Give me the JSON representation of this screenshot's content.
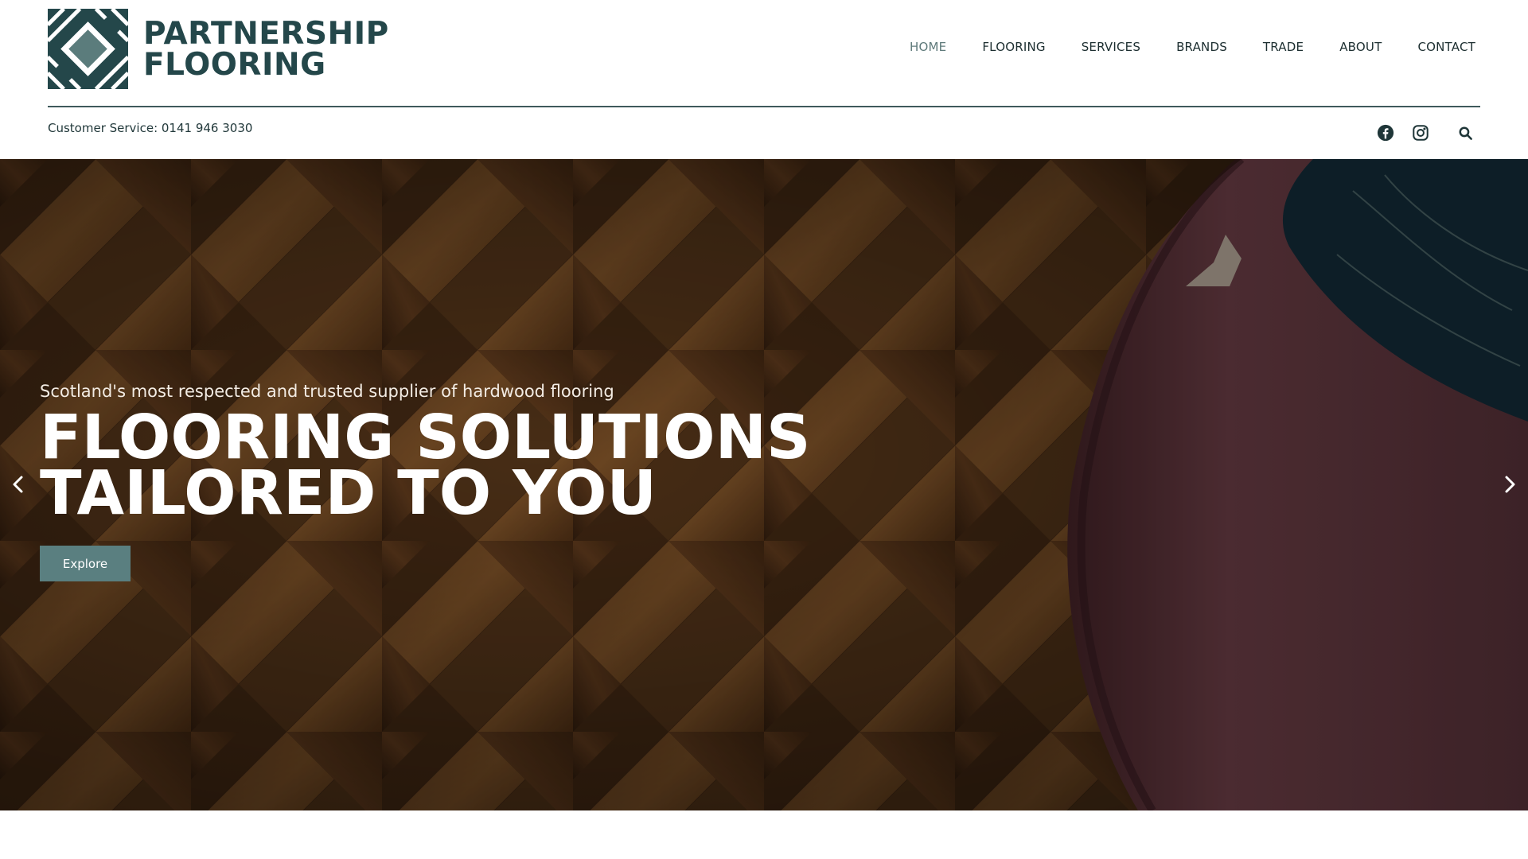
{
  "brand": {
    "line1": "PARTNERSHIP",
    "line2": "FLOORING",
    "color": "#24474a"
  },
  "nav": {
    "items": [
      {
        "label": "HOME",
        "active": true
      },
      {
        "label": "FLOORING",
        "active": false
      },
      {
        "label": "SERVICES",
        "active": false
      },
      {
        "label": "BRANDS",
        "active": false
      },
      {
        "label": "TRADE",
        "active": false
      },
      {
        "label": "ABOUT",
        "active": false
      },
      {
        "label": "CONTACT",
        "active": false
      }
    ]
  },
  "topbar": {
    "customer_service": "Customer Service: 0141 946 3030",
    "icons": [
      "facebook-icon",
      "instagram-icon",
      "search-icon"
    ]
  },
  "hero": {
    "subtitle": "Scotland's most respected and trusted supplier of hardwood flooring",
    "title": "FLOORING SOLUTIONS TAILORED TO YOU",
    "button_label": "Explore",
    "button_color": "#5a7f80",
    "prev_icon": "chevron-left-icon",
    "next_icon": "chevron-right-icon"
  }
}
